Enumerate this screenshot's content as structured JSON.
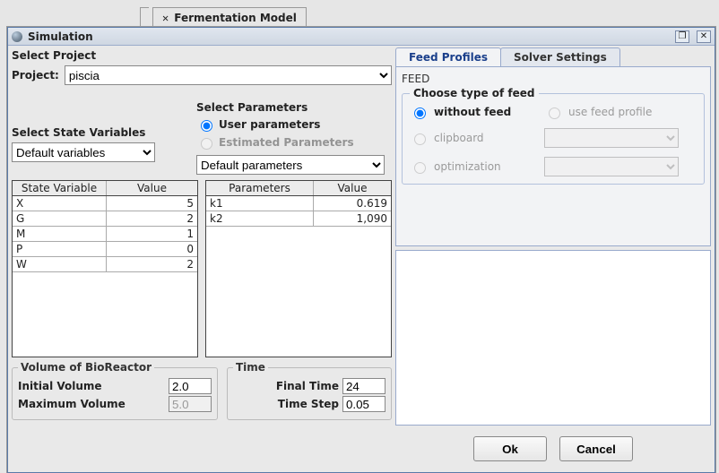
{
  "background_tab": {
    "close": "✕",
    "label": "Fermentation Model"
  },
  "window": {
    "title": "Simulation",
    "btn_max": "❐",
    "btn_cls": "✕"
  },
  "project": {
    "heading": "Select Project",
    "label": "Project:",
    "value": "piscia"
  },
  "state_vars": {
    "heading": "Select State Variables",
    "value": "Default variables"
  },
  "params": {
    "heading": "Select Parameters",
    "radio_user": "User parameters",
    "radio_est": "Estimated Parameters",
    "value": "Default parameters"
  },
  "table_sv": {
    "col1": "State Variable",
    "col2": "Value",
    "rows": [
      {
        "name": "X",
        "value": "5"
      },
      {
        "name": "G",
        "value": "2"
      },
      {
        "name": "M",
        "value": "1"
      },
      {
        "name": "P",
        "value": "0"
      },
      {
        "name": "W",
        "value": "2"
      }
    ]
  },
  "table_pr": {
    "col1": "Parameters",
    "col2": "Value",
    "rows": [
      {
        "name": "k1",
        "value": "0.619"
      },
      {
        "name": "k2",
        "value": "1,090"
      }
    ]
  },
  "volume": {
    "legend": "Volume of BioReactor",
    "initial_label": "Initial Volume",
    "initial_value": "2.0",
    "max_label": "Maximum Volume",
    "max_value": "5.0"
  },
  "time": {
    "legend": "Time",
    "final_label": "Final Time",
    "final_value": "24",
    "step_label": "Time Step",
    "step_value": "0.05"
  },
  "tabs": {
    "feed": "Feed Profiles",
    "solver": "Solver Settings"
  },
  "feed": {
    "section": "FEED",
    "legend": "Choose type of feed",
    "without": "without feed",
    "use_profile": "use feed profile",
    "clipboard": "clipboard",
    "optimization": "optimization"
  },
  "buttons": {
    "ok": "Ok",
    "cancel": "Cancel"
  }
}
